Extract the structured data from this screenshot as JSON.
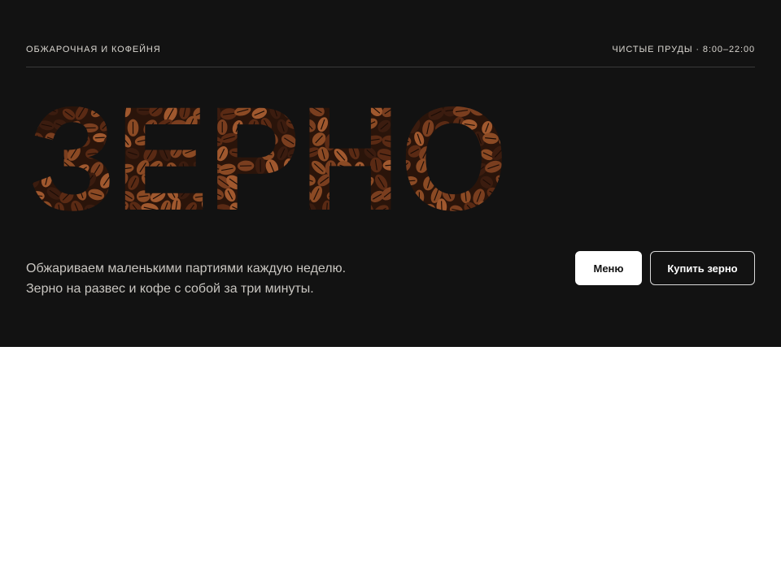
{
  "header": {
    "brand_tagline": "ОБЖАРОЧНАЯ И КОФЕЙНЯ",
    "location_hours": "ЧИСТЫЕ ПРУДЫ · 8:00–22:00"
  },
  "hero": {
    "wordmark": "ЗЕРНО",
    "wordmark_texture": "coffee-beans",
    "description_lines": [
      "Обжариваем маленькими партиями каждую неделю.",
      "Зерно на развес и кофе с собой за три минуты."
    ]
  },
  "actions": {
    "menu_label": "Меню",
    "buy_label": "Купить зерно"
  },
  "colors": {
    "hero_background": "#121212",
    "page_background": "#ffffff",
    "text_light": "#d9d6d0",
    "bean_dark": "#3b1c0f",
    "bean_mid": "#7a3e1f",
    "bean_light": "#a0582e"
  }
}
